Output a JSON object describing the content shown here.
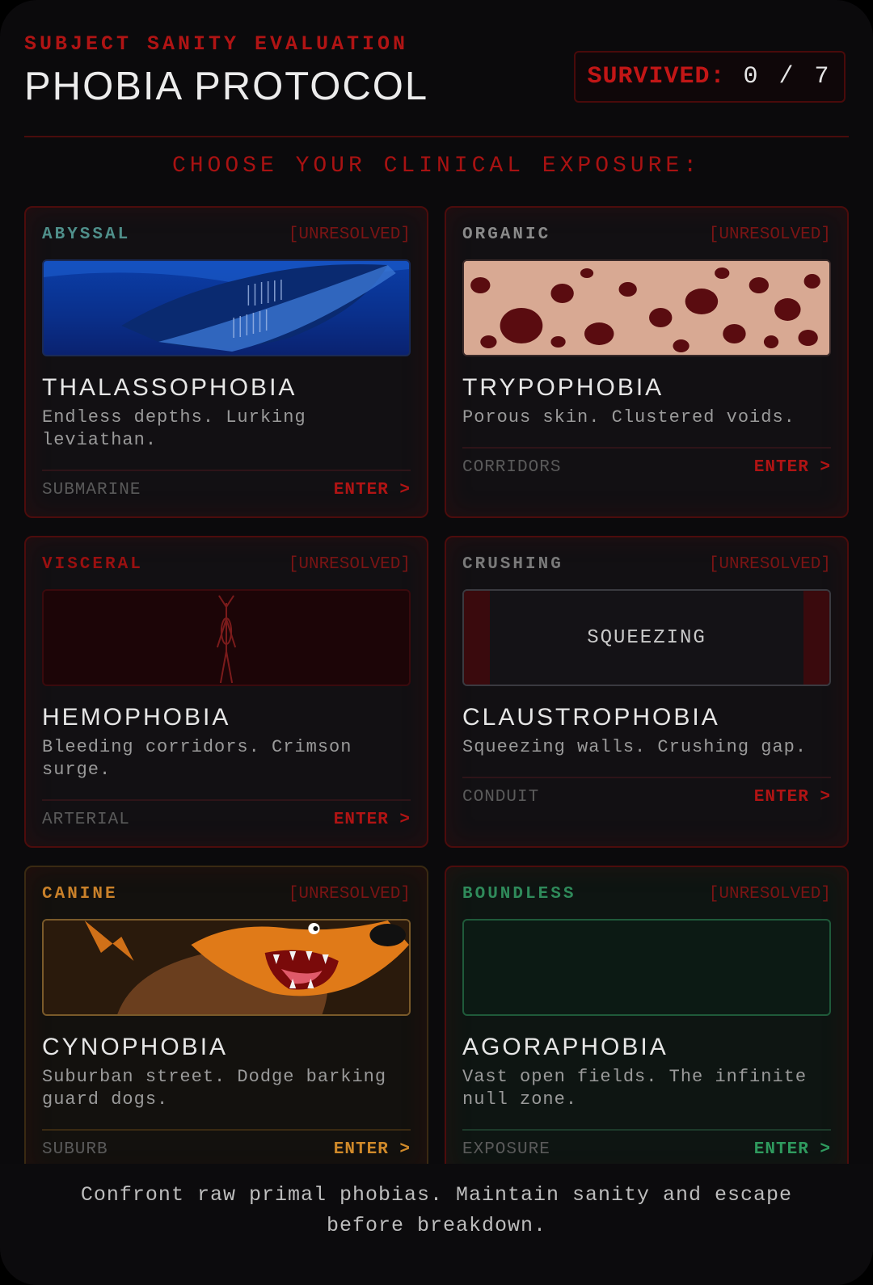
{
  "header": {
    "subtitle": "SUBJECT SANITY EVALUATION",
    "title": "PHOBIA PROTOCOL"
  },
  "survived": {
    "label": "SURVIVED:",
    "value": "0 / 7"
  },
  "prompt": "CHOOSE YOUR CLINICAL EXPOSURE:",
  "cards": [
    {
      "category": "ABYSSAL",
      "status": "[UNRESOLVED]",
      "name": "THALASSOPHOBIA",
      "description": "Endless depths. Lurking leviathan.",
      "zone": "SUBMARINE",
      "action": "ENTER >",
      "accent": "#4f8f8a"
    },
    {
      "category": "ORGANIC",
      "status": "[UNRESOLVED]",
      "name": "TRYPOPHOBIA",
      "description": "Porous skin. Clustered voids.",
      "zone": "CORRIDORS",
      "action": "ENTER >",
      "accent": "#8a8a8a"
    },
    {
      "category": "VISCERAL",
      "status": "[UNRESOLVED]",
      "name": "HEMOPHOBIA",
      "description": "Bleeding corridors. Crimson surge.",
      "zone": "ARTERIAL",
      "action": "ENTER >",
      "accent": "#9a1010"
    },
    {
      "category": "CRUSHING",
      "status": "[UNRESOLVED]",
      "name": "CLAUSTROPHOBIA",
      "description": "Squeezing walls. Crushing gap.",
      "zone": "CONDUIT",
      "action": "ENTER >",
      "thumb_label": "SQUEEZING",
      "accent": "#7a7a7a"
    },
    {
      "category": "CANINE",
      "status": "[UNRESOLVED]",
      "name": "CYNOPHOBIA",
      "description": "Suburban street. Dodge barking guard dogs.",
      "zone": "SUBURB",
      "action": "ENTER >",
      "accent": "#c9812a"
    },
    {
      "category": "BOUNDLESS",
      "status": "[UNRESOLVED]",
      "name": "AGORAPHOBIA",
      "description": "Vast open fields. The infinite null zone.",
      "zone": "EXPOSURE",
      "action": "ENTER >",
      "accent": "#2f8a5a"
    }
  ],
  "footer": "Confront raw primal phobias. Maintain sanity and escape before breakdown.",
  "colors": {
    "background": "#0b0a0c",
    "danger_red": "#b01414",
    "card_border": "#4d0c0c"
  }
}
